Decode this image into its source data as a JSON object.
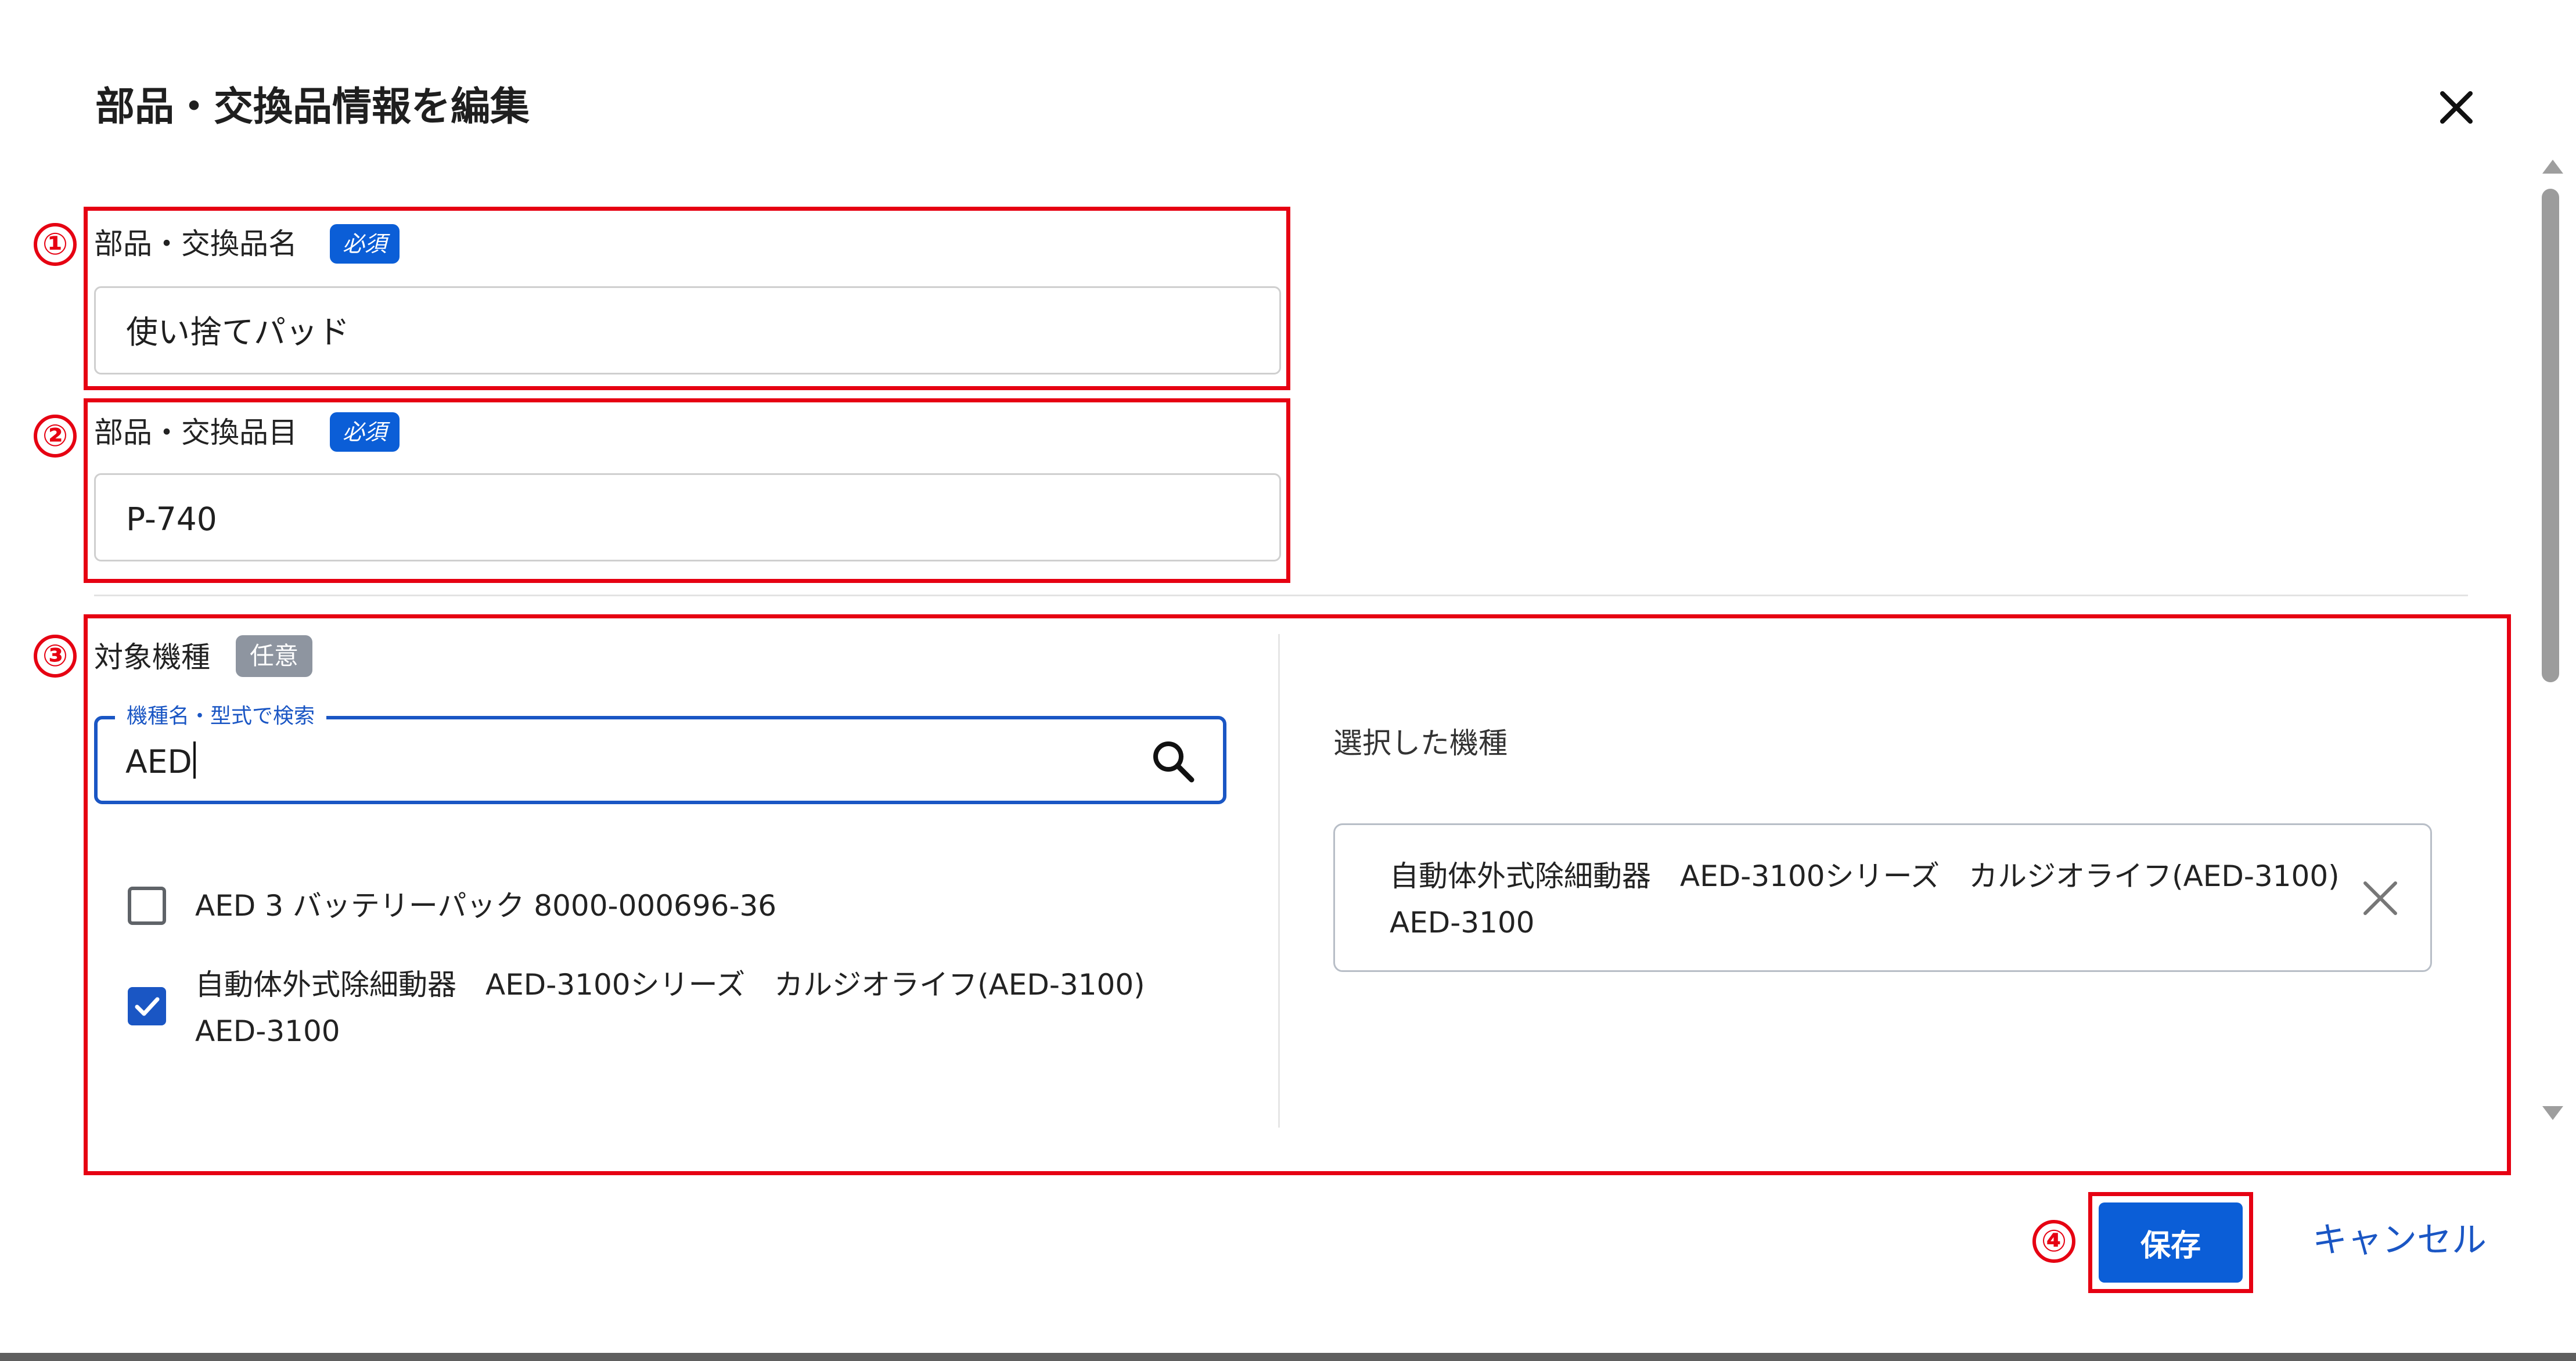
{
  "dialog": {
    "title": "部品・交換品情報を編集",
    "close_icon": "close-icon"
  },
  "annotations": {
    "step1": "①",
    "step2": "②",
    "step3": "③",
    "step4": "④",
    "color": "#e60012"
  },
  "fields": {
    "part_name": {
      "label": "部品・交換品名",
      "badge": "必須",
      "value": "使い捨てパッド"
    },
    "part_number": {
      "label": "部品・交換品目",
      "badge": "必須",
      "value": "P-740"
    },
    "target_models": {
      "label": "対象機種",
      "badge": "任意",
      "search_label": "機種名・型式で検索",
      "search_value": "AED",
      "search_icon": "search-icon",
      "results": [
        {
          "line1": "AED 3 バッテリーパック 8000-000696-36",
          "line2": "",
          "checked": false
        },
        {
          "line1": "自動体外式除細動器　AED-3100シリーズ　カルジオライフ(AED-3100)",
          "line2": "AED-3100",
          "checked": true
        }
      ],
      "selected_title": "選択した機種",
      "selected": [
        {
          "line1": "自動体外式除細動器　AED-3100シリーズ　カルジオライフ(AED-3100)",
          "line2": "AED-3100"
        }
      ]
    }
  },
  "actions": {
    "save_label": "保存",
    "cancel_label": "キャンセル"
  },
  "colors": {
    "primary": "#0b5ed7",
    "required_badge": "#0b5ed7",
    "optional_badge": "#8e95a0"
  }
}
